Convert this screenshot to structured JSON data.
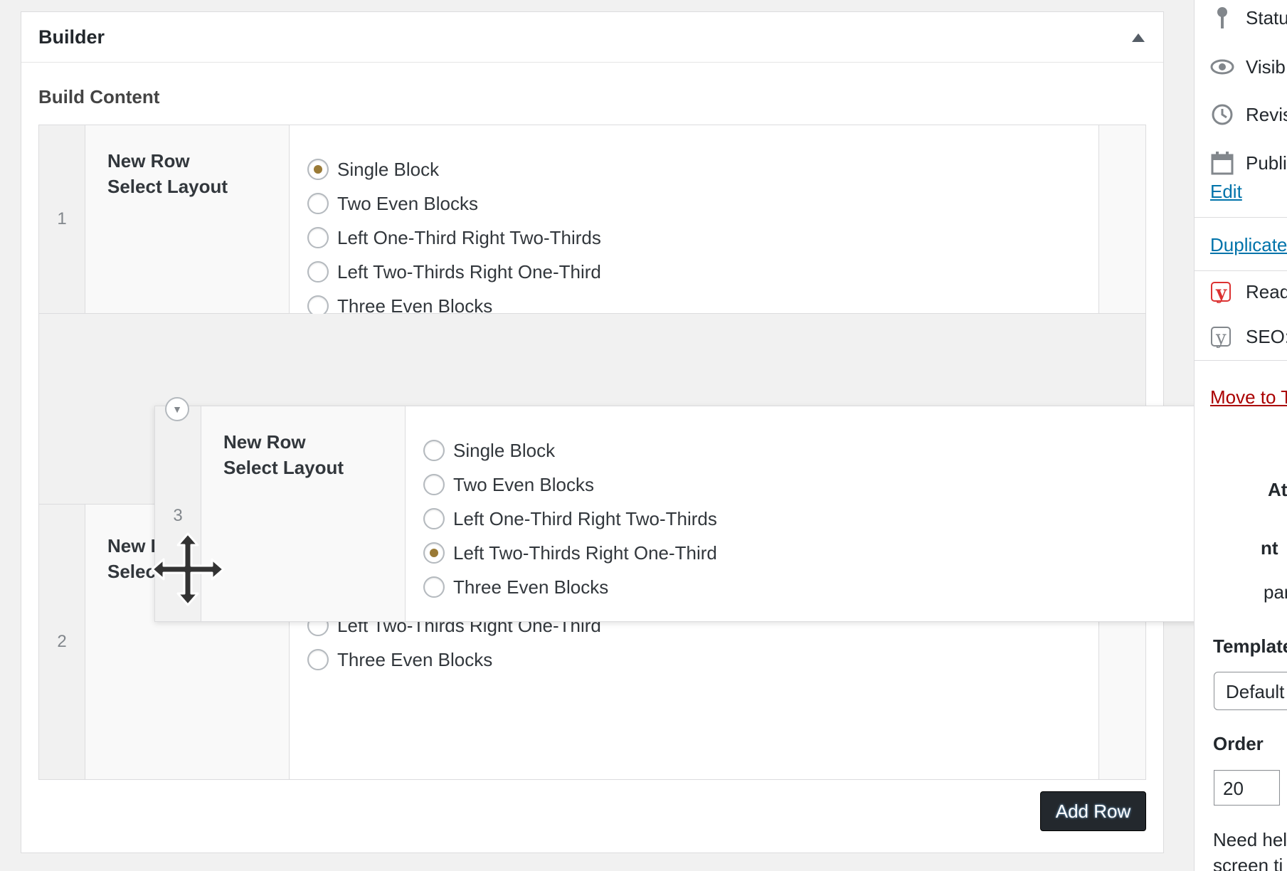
{
  "builder": {
    "title": "Builder",
    "build_content_label": "Build Content",
    "add_row_label": "Add Row"
  },
  "layout_options": [
    "Single Block",
    "Two Even Blocks",
    "Left One-Third Right Two-Thirds",
    "Left Two-Thirds Right One-Third",
    "Three Even Blocks"
  ],
  "rows": [
    {
      "number": "1",
      "title": "New Row",
      "subtitle": "Select Layout",
      "selected": "Single Block"
    },
    {
      "number": "2",
      "title": "New Row",
      "subtitle": "Select Layout",
      "selected": "Two Even Blocks"
    }
  ],
  "dragged_row": {
    "number": "3",
    "title": "New Row",
    "subtitle": "Select Layout",
    "selected": "Left Two-Thirds Right One-Third"
  },
  "sidebar": {
    "status": "Statu",
    "visibility": "Visib",
    "revisions": "Revis",
    "publish": "Publi",
    "edit_link": "Edit",
    "duplicate_link": "Duplicate",
    "readability": "Reada",
    "seo": "SEO:",
    "move_to_trash": "Move to T",
    "attributes_heading": "At",
    "parent_label": "nt",
    "parent_value": "par",
    "template_label": "Template",
    "template_value": "Default",
    "order_label": "Order",
    "order_value": "20",
    "help_line1": "Need hel",
    "help_line2": "screen ti"
  },
  "colors": {
    "radio_checked": "#9a7a36",
    "link": "#0073aa",
    "trash": "#aa0000",
    "yoast_red": "#dc3232",
    "button_bg": "#23282d"
  }
}
